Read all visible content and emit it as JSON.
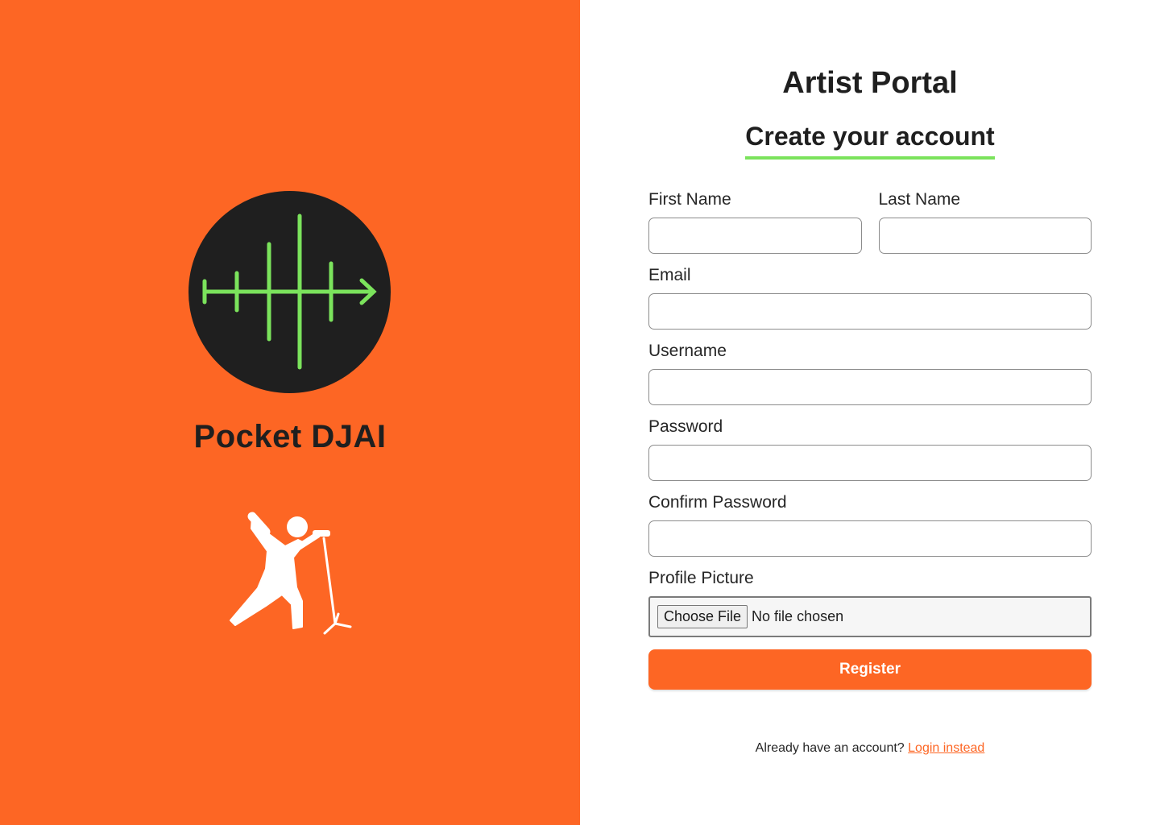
{
  "brand": {
    "name": "Pocket DJAI",
    "logo_icon": "waveform-arrow-icon",
    "illustration_icon": "singer-with-microphone-icon",
    "accent_color": "#fd6624",
    "logo_bg_color": "#1f1f1f",
    "logo_line_color": "#7be35c"
  },
  "header": {
    "title": "Artist Portal",
    "subtitle": "Create your account",
    "underline_color": "#7be35c"
  },
  "form": {
    "first_name": {
      "label": "First Name",
      "value": "",
      "placeholder": ""
    },
    "last_name": {
      "label": "Last Name",
      "value": "",
      "placeholder": ""
    },
    "email": {
      "label": "Email",
      "value": "",
      "placeholder": ""
    },
    "username": {
      "label": "Username",
      "value": "",
      "placeholder": ""
    },
    "password": {
      "label": "Password",
      "value": "",
      "placeholder": ""
    },
    "confirm_password": {
      "label": "Confirm Password",
      "value": "",
      "placeholder": ""
    },
    "profile_picture": {
      "label": "Profile Picture",
      "button_label": "Choose File",
      "status": "No file chosen"
    },
    "submit_label": "Register"
  },
  "footer": {
    "prompt": "Already have an account?",
    "link_label": "Login instead"
  }
}
